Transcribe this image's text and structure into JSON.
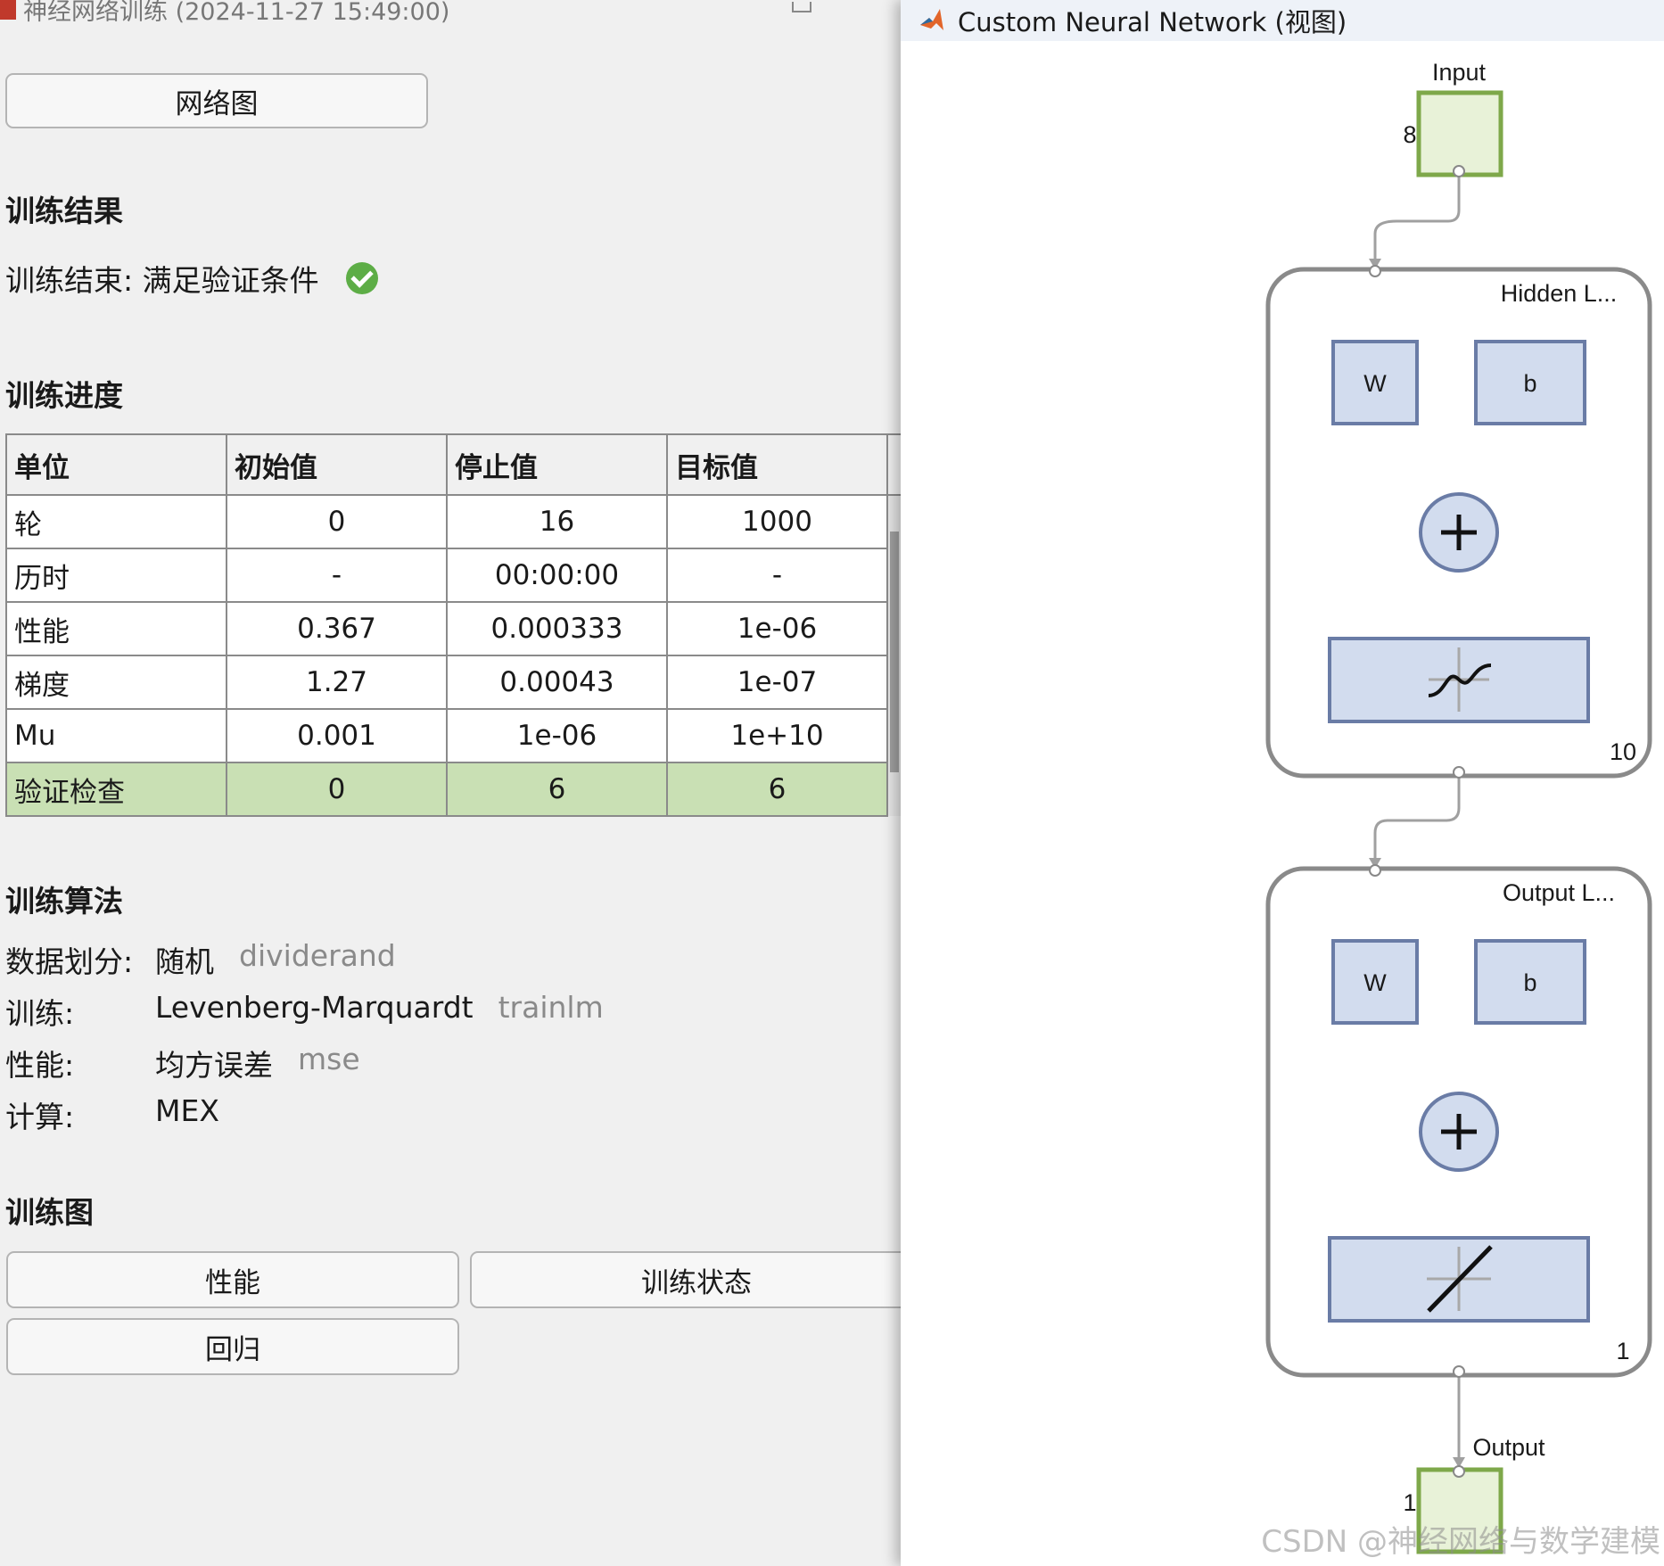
{
  "left_window": {
    "title": "神经网络训练 (2024-11-27 15:49:00)",
    "network_diagram_button": "网络图",
    "results": {
      "heading": "训练结果",
      "status_text": "训练结束: 满足验证条件"
    },
    "progress": {
      "heading": "训练进度",
      "columns": [
        "单位",
        "初始值",
        "停止值",
        "目标值"
      ],
      "rows": [
        {
          "unit": "轮",
          "initial": "0",
          "stopped": "16",
          "target": "1000"
        },
        {
          "unit": "历时",
          "initial": "-",
          "stopped": "00:00:00",
          "target": "-"
        },
        {
          "unit": "性能",
          "initial": "0.367",
          "stopped": "0.000333",
          "target": "1e-06"
        },
        {
          "unit": "梯度",
          "initial": "1.27",
          "stopped": "0.00043",
          "target": "1e-07"
        },
        {
          "unit": "Mu",
          "initial": "0.001",
          "stopped": "1e-06",
          "target": "1e+10"
        },
        {
          "unit": "验证检查",
          "initial": "0",
          "stopped": "6",
          "target": "6"
        }
      ],
      "highlight_color": "#c9e0b4"
    },
    "algorithms": {
      "heading": "训练算法",
      "data_division": {
        "label": "数据划分:",
        "value": "随机",
        "fn": "dividerand"
      },
      "training": {
        "label": "训练:",
        "value": "Levenberg-Marquardt",
        "fn": "trainlm"
      },
      "performance": {
        "label": "性能:",
        "value": "均方误差",
        "fn": "mse"
      },
      "calculation": {
        "label": "计算:",
        "value": "MEX"
      }
    },
    "plots": {
      "heading": "训练图",
      "performance_button": "性能",
      "training_state_button": "训练状态",
      "regression_button": "回归"
    }
  },
  "right_window": {
    "title": "Custom Neural Network (视图)",
    "diagram": {
      "input_label": "Input",
      "input_size": "8",
      "hidden_layer_label": "Hidden L...",
      "hidden_size": "10",
      "output_layer_label": "Output L...",
      "output_layer_size": "1",
      "output_label": "Output",
      "output_size": "1",
      "weight_label": "W",
      "bias_label": "b",
      "hidden_transfer_icon": "sigmoid-icon",
      "output_transfer_icon": "linear-icon",
      "colors": {
        "io_fill": "#e8f2d8",
        "io_border": "#7ea84a",
        "block_fill": "#d2dcee",
        "block_border": "#6a7ca6",
        "layer_border": "#8a8a8a",
        "wire": "#a0a0a0"
      }
    }
  },
  "watermark": "CSDN @神经网络与数学建模"
}
